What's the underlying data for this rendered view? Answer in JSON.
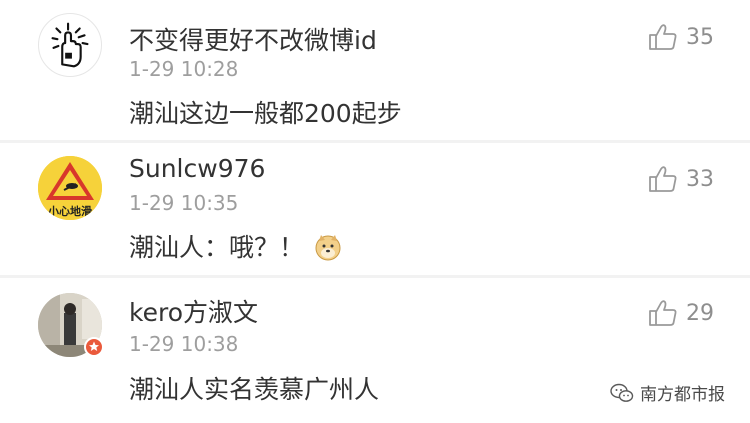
{
  "comments": [
    {
      "username": "不变得更好不改微博id",
      "time": "1-29 10:28",
      "text": "潮汕这边一般都200起步",
      "likes": "35",
      "avatar_icon": "hand-drawing-avatar"
    },
    {
      "username": "Sunlcw976",
      "time": "1-29 10:35",
      "text": "潮汕人：哦？！",
      "likes": "33",
      "avatar_icon": "caution-sign-avatar",
      "avatar_text": "小心地滑",
      "emoji": "doge-emoji"
    },
    {
      "username": "kero方淑文",
      "time": "1-29 10:38",
      "text": "潮汕人实名羡慕广州人",
      "likes": "29",
      "avatar_icon": "photo-avatar",
      "badge_icon": "verified-star-icon"
    }
  ],
  "watermark": {
    "text": "南方都市报",
    "icon": "wechat-icon"
  },
  "colors": {
    "background": "#f2f2f2",
    "card": "#ffffff",
    "text": "#333333",
    "meta": "#9e9e9e",
    "badge": "#ea5a3c"
  }
}
